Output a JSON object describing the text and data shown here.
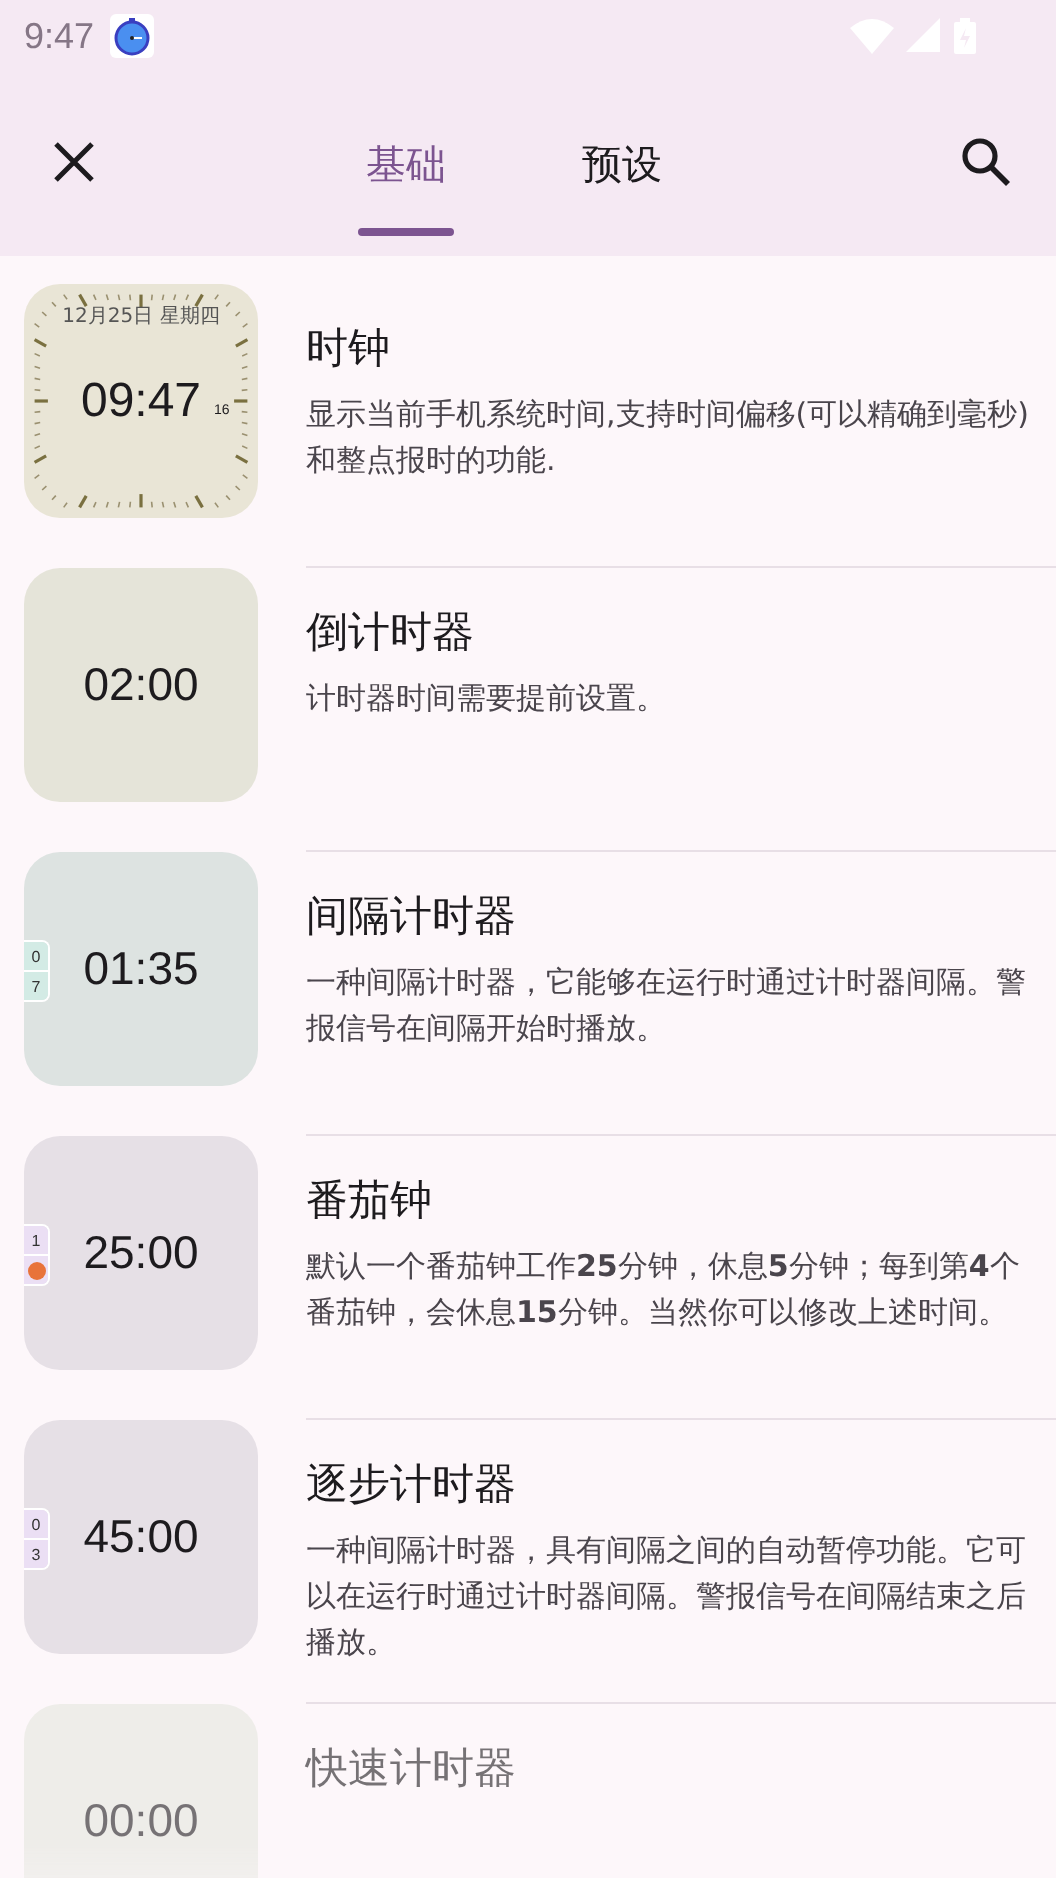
{
  "status_bar": {
    "time": "9:47"
  },
  "tabs": [
    {
      "label": "基础",
      "selected": true
    },
    {
      "label": "预设",
      "selected": false
    }
  ],
  "items": [
    {
      "title": "时钟",
      "description": "显示当前手机系统时间,支持时间偏移(可以精确到毫秒)和整点报时的功能.",
      "faded": false,
      "tile": {
        "kind": "clock",
        "time": "09:47",
        "seconds": "16",
        "date": "12月25日 星期四",
        "color": "#e9e5d6"
      }
    },
    {
      "title": "倒计时器",
      "description": "计时器时间需要提前设置。",
      "faded": false,
      "tile": {
        "kind": "plain",
        "time": "02:00",
        "color": "#e5e4d9"
      }
    },
    {
      "title": "间隔计时器",
      "description": "一种间隔计时器，它能够在运行时通过计时器间隔。警报信号在间隔开始时播放。",
      "faded": false,
      "tile": {
        "kind": "side",
        "time": "01:35",
        "color": "#dde3e1",
        "tabs": [
          {
            "kind": "text",
            "text": "0",
            "color": "#d3ebe5"
          },
          {
            "kind": "text",
            "text": "7",
            "color": "#d3ebe5"
          }
        ]
      }
    },
    {
      "title": "番茄钟",
      "description": "默认一个番茄钟工作**25**分钟，休息**5**分钟；每到第**4**个番茄钟，会休息**15**分钟。当然你可以修改上述时间。",
      "faded": false,
      "tile": {
        "kind": "side",
        "time": "25:00",
        "color": "#e6e0e6",
        "tabs": [
          {
            "kind": "text",
            "text": "1",
            "color": "#ebdff4"
          },
          {
            "kind": "dot",
            "color": "#ebdff4"
          }
        ]
      }
    },
    {
      "title": "逐步计时器",
      "description": "一种间隔计时器，具有间隔之间的自动暂停功能。它可以在运行时通过计时器间隔。警报信号在间隔结束之后播放。",
      "faded": false,
      "tile": {
        "kind": "side",
        "time": "45:00",
        "color": "#e6e0e6",
        "tabs": [
          {
            "kind": "text",
            "text": "0",
            "color": "#ebdff4"
          },
          {
            "kind": "text",
            "text": "3",
            "color": "#ebdff4"
          }
        ]
      }
    },
    {
      "title": "快速计时器",
      "faded": true,
      "tile": {
        "kind": "plain",
        "time": "00:00",
        "color": "#e5e7df"
      }
    }
  ]
}
